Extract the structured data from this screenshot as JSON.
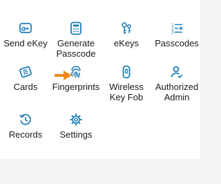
{
  "tiles": [
    {
      "label": "Send eKey",
      "icon": "send-ekey-icon"
    },
    {
      "label": "Generate\nPasscode",
      "icon": "generate-passcode-icon"
    },
    {
      "label": "eKeys",
      "icon": "ekeys-icon"
    },
    {
      "label": "Passcodes",
      "icon": "passcodes-icon"
    },
    {
      "label": "Cards",
      "icon": "cards-icon"
    },
    {
      "label": "Fingerprints",
      "icon": "fingerprint-icon"
    },
    {
      "label": "Wireless\nKey Fob",
      "icon": "key-fob-icon"
    },
    {
      "label": "Authorized\nAdmin",
      "icon": "authorized-admin-icon"
    },
    {
      "label": "Records",
      "icon": "records-icon"
    },
    {
      "label": "Settings",
      "icon": "settings-icon"
    }
  ],
  "colors": {
    "icon": "#1f7fb6",
    "arrow": "#f08a1c",
    "text": "#1b1b1b",
    "background": "#ffffff",
    "outer": "#f3f3f5"
  }
}
